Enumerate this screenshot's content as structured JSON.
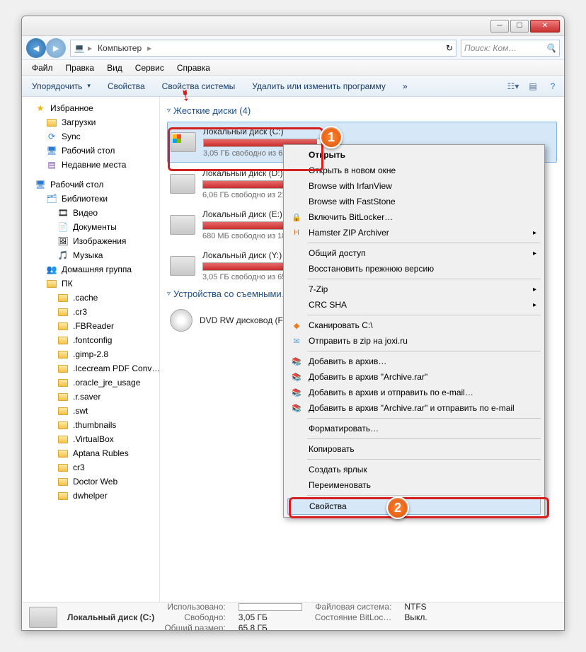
{
  "breadcrumb": {
    "root_icon": "💻",
    "item1": "Компьютер",
    "sep": "▸"
  },
  "search": {
    "placeholder": "Поиск: Ком…",
    "icon": "🔍"
  },
  "menubar": [
    "Файл",
    "Правка",
    "Вид",
    "Сервис",
    "Справка"
  ],
  "toolbar": {
    "organize": "Упорядочить",
    "props": "Свойства",
    "sysprops": "Свойства системы",
    "uninstall": "Удалить или изменить программу",
    "more": "»"
  },
  "nav": {
    "favorites": {
      "title": "Избранное",
      "items": [
        "Загрузки",
        "Sync",
        "Рабочий стол",
        "Недавние места"
      ]
    },
    "desktop": {
      "title": "Рабочий стол"
    },
    "libraries": {
      "title": "Библиотеки",
      "items": [
        "Видео",
        "Документы",
        "Изображения",
        "Музыка"
      ]
    },
    "homegroup": "Домашняя группа",
    "pc": {
      "title": "ПК",
      "items": [
        ".cache",
        ".cr3",
        ".FBReader",
        ".fontconfig",
        ".gimp-2.8",
        ".Icecream PDF Conv…",
        ".oracle_jre_usage",
        ".r.saver",
        ".swt",
        ".thumbnails",
        ".VirtualBox",
        "Aptana Rubles",
        "cr3",
        "Doctor Web",
        "dwhelper"
      ]
    }
  },
  "groups": {
    "hdd": {
      "title": "Жесткие диски (4)"
    },
    "removable": {
      "title": "Устройства со съемными…"
    }
  },
  "drives": [
    {
      "name": "Локальный диск (C:)",
      "free": "3,05 ГБ свободно из 65,8 ГБ",
      "fill": 95,
      "os": true
    },
    {
      "name": "Локальный диск (D:)",
      "free": "6,06 ГБ свободно из 21…",
      "fill": 88
    },
    {
      "name": "Локальный диск (E:)",
      "free": "680 МБ свободно из 18…",
      "fill": 96
    },
    {
      "name": "Локальный диск (Y:)",
      "free": "3,05 ГБ свободно из 65…",
      "fill": 95
    }
  ],
  "dvd": {
    "name": "DVD RW дисковод (F:)"
  },
  "context": {
    "open": "Открыть",
    "open_new": "Открыть в новом окне",
    "irfan": "Browse with IrfanView",
    "faststone": "Browse with FastStone",
    "bitlocker": "Включить BitLocker…",
    "hamster": "Hamster ZIP Archiver",
    "share": "Общий доступ",
    "restore": "Восстановить прежнюю версию",
    "sevenzip": "7-Zip",
    "crcsha": "CRC SHA",
    "scan": "Сканировать C:\\",
    "joxi": "Отправить в zip на joxi.ru",
    "rar1": "Добавить в архив…",
    "rar2": "Добавить в архив \"Archive.rar\"",
    "rar3": "Добавить в архив и отправить по e-mail…",
    "rar4": "Добавить в архив \"Archive.rar\" и отправить по e-mail",
    "format": "Форматировать…",
    "copy": "Копировать",
    "shortcut": "Создать ярлык",
    "rename": "Переименовать",
    "properties": "Свойства"
  },
  "status": {
    "name": "Локальный диск (C:)",
    "used_lbl": "Использовано:",
    "free_lbl": "Свободно:",
    "free_val": "3,05 ГБ",
    "total_lbl": "Общий размер:",
    "total_val": "65,8 ГБ",
    "fs_lbl": "Файловая система:",
    "fs_val": "NTFS",
    "bl_lbl": "Состояние BitLoc…",
    "bl_val": "Выкл."
  },
  "markers": {
    "m1": "1",
    "m2": "2"
  }
}
